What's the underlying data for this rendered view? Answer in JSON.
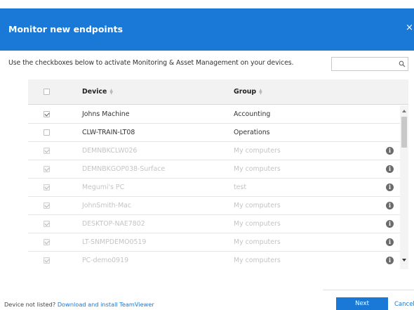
{
  "dialog": {
    "title": "Monitor new endpoints",
    "close_icon": "close-icon",
    "close_glyph": "×",
    "accent_color": "#1a78d6"
  },
  "instruction": "Use the checkboxes below to activate Monitoring & Asset Management on your devices.",
  "search": {
    "placeholder": "",
    "value": "",
    "icon": "search-icon"
  },
  "table": {
    "columns": [
      {
        "label": "",
        "type": "select-all-checkbox",
        "checked": false
      },
      {
        "label": "Device",
        "sortable": true
      },
      {
        "label": "Group",
        "sortable": true
      }
    ],
    "rows": [
      {
        "device": "Johns Machine",
        "group": "Accounting",
        "checked": true,
        "disabled": false,
        "info": false
      },
      {
        "device": "CLW-TRAIN-LT08",
        "group": "Operations",
        "checked": false,
        "disabled": false,
        "info": false
      },
      {
        "device": "DEMNBKCLW026",
        "group": "My computers",
        "checked": true,
        "disabled": true,
        "info": true
      },
      {
        "device": "DEMNBKGOP038-Surface",
        "group": "My computers",
        "checked": true,
        "disabled": true,
        "info": true
      },
      {
        "device": "Megumi's PC",
        "group": "test",
        "checked": true,
        "disabled": true,
        "info": true
      },
      {
        "device": "JohnSmith-Mac",
        "group": "My computers",
        "checked": true,
        "disabled": true,
        "info": true
      },
      {
        "device": "DESKTOP-NAE7802",
        "group": "My computers",
        "checked": true,
        "disabled": true,
        "info": true
      },
      {
        "device": "LT-SNMPDEMO0519",
        "group": "My computers",
        "checked": true,
        "disabled": true,
        "info": true
      },
      {
        "device": "PC-demo0919",
        "group": "My computers",
        "checked": true,
        "disabled": true,
        "info": true
      }
    ],
    "info_glyph": "i"
  },
  "footer": {
    "prompt": "Device not listed?",
    "link": "Download and install TeamViewer",
    "next_label": "Next",
    "cancel_label": "Cancel"
  }
}
